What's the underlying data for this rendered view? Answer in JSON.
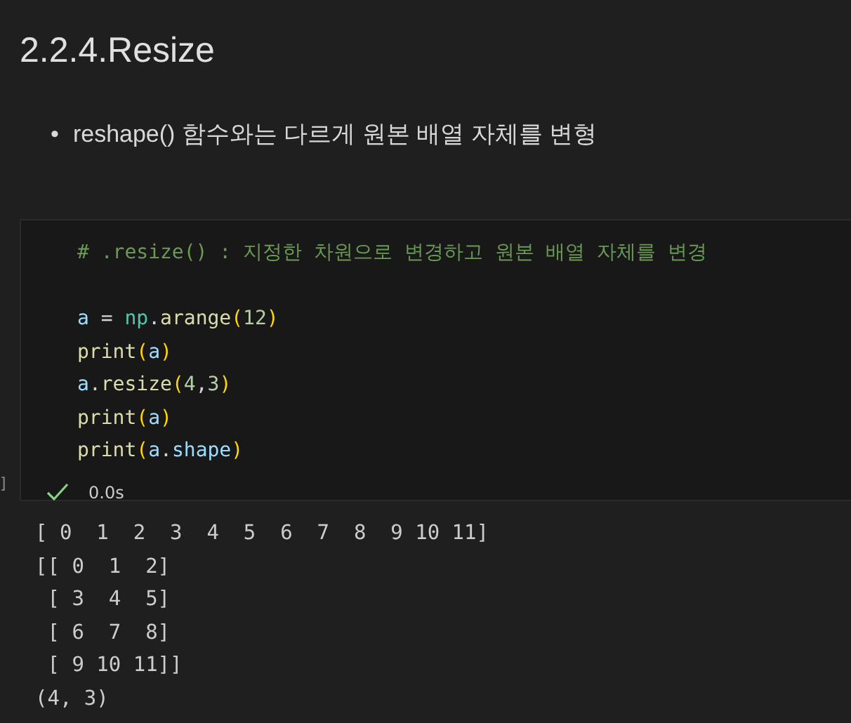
{
  "heading": "2.2.4.Resize",
  "bullets": [
    {
      "marker": "•",
      "text": "reshape() 함수와는 다르게 원본 배열 자체를 변형"
    }
  ],
  "cell": {
    "code_lines": [
      [
        {
          "kind": "comment",
          "text": "# .resize() : 지정한 차원으로 변경하고 원본 배열 자체를 변경"
        }
      ],
      [
        {
          "kind": "blank"
        }
      ],
      [
        {
          "kind": "var",
          "text": "a"
        },
        {
          "kind": "plain",
          "text": " = "
        },
        {
          "kind": "module",
          "text": "np"
        },
        {
          "kind": "plain",
          "text": "."
        },
        {
          "kind": "func",
          "text": "arange"
        },
        {
          "kind": "paren",
          "text": "("
        },
        {
          "kind": "number",
          "text": "12"
        },
        {
          "kind": "paren",
          "text": ")"
        }
      ],
      [
        {
          "kind": "func",
          "text": "print"
        },
        {
          "kind": "paren",
          "text": "("
        },
        {
          "kind": "var",
          "text": "a"
        },
        {
          "kind": "paren",
          "text": ")"
        }
      ],
      [
        {
          "kind": "var",
          "text": "a"
        },
        {
          "kind": "plain",
          "text": "."
        },
        {
          "kind": "func",
          "text": "resize"
        },
        {
          "kind": "paren",
          "text": "("
        },
        {
          "kind": "number",
          "text": "4"
        },
        {
          "kind": "plain",
          "text": ","
        },
        {
          "kind": "number",
          "text": "3"
        },
        {
          "kind": "paren",
          "text": ")"
        }
      ],
      [
        {
          "kind": "func",
          "text": "print"
        },
        {
          "kind": "paren",
          "text": "("
        },
        {
          "kind": "var",
          "text": "a"
        },
        {
          "kind": "paren",
          "text": ")"
        }
      ],
      [
        {
          "kind": "func",
          "text": "print"
        },
        {
          "kind": "paren",
          "text": "("
        },
        {
          "kind": "var",
          "text": "a"
        },
        {
          "kind": "plain",
          "text": "."
        },
        {
          "kind": "var",
          "text": "shape"
        },
        {
          "kind": "paren",
          "text": ")"
        }
      ]
    ],
    "execution_count": "]",
    "succeeded": true,
    "duration": "0.0s"
  },
  "output_lines": [
    "[ 0  1  2  3  4  5  6  7  8  9 10 11]",
    "[[ 0  1  2]",
    " [ 3  4  5]",
    " [ 6  7  8]",
    " [ 9 10 11]]",
    "(4, 3)"
  ]
}
